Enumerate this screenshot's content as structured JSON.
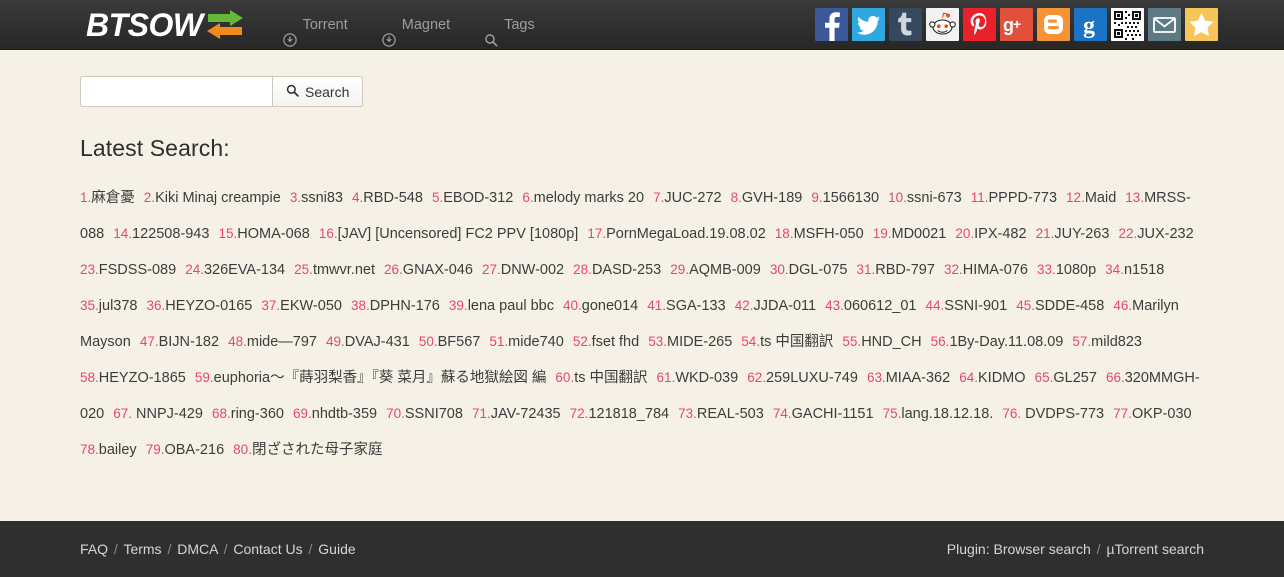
{
  "header": {
    "brand": "BTSOW",
    "nav": [
      {
        "label": "Torrent",
        "icon": "download-circle-icon"
      },
      {
        "label": "Magnet",
        "icon": "download-circle-icon"
      },
      {
        "label": "Tags",
        "icon": "search-icon"
      }
    ],
    "social": [
      {
        "name": "facebook",
        "glyph": "f",
        "color": "#3b5998"
      },
      {
        "name": "twitter",
        "glyph": "t",
        "color": "#2fa8e1"
      },
      {
        "name": "tumblr",
        "glyph": "t",
        "color": "#34495e"
      },
      {
        "name": "reddit",
        "glyph": "r",
        "color": "#f2f2f2"
      },
      {
        "name": "pinterest",
        "glyph": "P",
        "color": "#e8212b"
      },
      {
        "name": "google-plus",
        "glyph": "g+",
        "color": "#e0503b"
      },
      {
        "name": "blogger",
        "glyph": "B",
        "color": "#f79337"
      },
      {
        "name": "google",
        "glyph": "g",
        "color": "#1a73c4"
      },
      {
        "name": "qr-code",
        "glyph": "",
        "color": "#ffffff"
      },
      {
        "name": "email",
        "glyph": "",
        "color": "#5d7b84"
      },
      {
        "name": "favorite",
        "glyph": "",
        "color": "#f7c65a"
      }
    ]
  },
  "search": {
    "value": "",
    "placeholder": "",
    "button_label": "Search"
  },
  "main": {
    "latest_title": "Latest Search:",
    "items": [
      {
        "n": "1.",
        "text": "麻倉憂"
      },
      {
        "n": "2.",
        "text": "Kiki Minaj creampie"
      },
      {
        "n": "3.",
        "text": "ssni83"
      },
      {
        "n": "4.",
        "text": "RBD-548"
      },
      {
        "n": "5.",
        "text": "EBOD-312"
      },
      {
        "n": "6.",
        "text": "melody marks 20"
      },
      {
        "n": "7.",
        "text": "JUC-272"
      },
      {
        "n": "8.",
        "text": "GVH-189"
      },
      {
        "n": "9.",
        "text": "1566130"
      },
      {
        "n": "10.",
        "text": "ssni-673"
      },
      {
        "n": "11.",
        "text": "PPPD-773"
      },
      {
        "n": "12.",
        "text": "Maid"
      },
      {
        "n": "13.",
        "text": "MRSS-088"
      },
      {
        "n": "14.",
        "text": "122508-943"
      },
      {
        "n": "15.",
        "text": "HOMA-068"
      },
      {
        "n": "16.",
        "text": "[JAV] [Uncensored] FC2 PPV [1080p]"
      },
      {
        "n": "17.",
        "text": "PornMegaLoad.19.08.02"
      },
      {
        "n": "18.",
        "text": "MSFH-050"
      },
      {
        "n": "19.",
        "text": "MD0021"
      },
      {
        "n": "20.",
        "text": "IPX-482"
      },
      {
        "n": "21.",
        "text": "JUY-263"
      },
      {
        "n": "22.",
        "text": "JUX-232"
      },
      {
        "n": "23.",
        "text": "FSDSS-089"
      },
      {
        "n": "24.",
        "text": "326EVA-134"
      },
      {
        "n": "25.",
        "text": "tmwvr.net"
      },
      {
        "n": "26.",
        "text": "GNAX-046"
      },
      {
        "n": "27.",
        "text": "DNW-002"
      },
      {
        "n": "28.",
        "text": "DASD-253"
      },
      {
        "n": "29.",
        "text": "AQMB-009"
      },
      {
        "n": "30.",
        "text": "DGL-075"
      },
      {
        "n": "31.",
        "text": "RBD-797"
      },
      {
        "n": "32.",
        "text": "HIMA-076"
      },
      {
        "n": "33.",
        "text": "1080p"
      },
      {
        "n": "34.",
        "text": "n1518"
      },
      {
        "n": "35.",
        "text": "jul378"
      },
      {
        "n": "36.",
        "text": "HEYZO-0165"
      },
      {
        "n": "37.",
        "text": "EKW-050"
      },
      {
        "n": "38.",
        "text": "DPHN-176"
      },
      {
        "n": "39.",
        "text": "lena paul bbc"
      },
      {
        "n": "40.",
        "text": "gone014"
      },
      {
        "n": "41.",
        "text": "SGA-133"
      },
      {
        "n": "42.",
        "text": "JJDA-011"
      },
      {
        "n": "43.",
        "text": "060612_01"
      },
      {
        "n": "44.",
        "text": "SSNI-901"
      },
      {
        "n": "45.",
        "text": "SDDE-458"
      },
      {
        "n": "46.",
        "text": "Marilyn Mayson"
      },
      {
        "n": "47.",
        "text": "BIJN-182"
      },
      {
        "n": "48.",
        "text": "mide—797"
      },
      {
        "n": "49.",
        "text": "DVAJ-431"
      },
      {
        "n": "50.",
        "text": "BF567"
      },
      {
        "n": "51.",
        "text": "mide740"
      },
      {
        "n": "52.",
        "text": "fset fhd"
      },
      {
        "n": "53.",
        "text": "MIDE-265"
      },
      {
        "n": "54.",
        "text": "ts 中国翻訳"
      },
      {
        "n": "55.",
        "text": "HND_CH"
      },
      {
        "n": "56.",
        "text": "1By-Day.11.08.09"
      },
      {
        "n": "57.",
        "text": "mild823"
      },
      {
        "n": "58.",
        "text": "HEYZO-1865"
      },
      {
        "n": "59.",
        "text": "euphoria～『蒔羽梨香』『葵 菜月』蘇る地獄絵図 編"
      },
      {
        "n": "60.",
        "text": "ts 中国翻訳"
      },
      {
        "n": "61.",
        "text": "WKD-039"
      },
      {
        "n": "62.",
        "text": "259LUXU-749"
      },
      {
        "n": "63.",
        "text": "MIAA-362"
      },
      {
        "n": "64.",
        "text": "KIDMO"
      },
      {
        "n": "65.",
        "text": "GL257"
      },
      {
        "n": "66.",
        "text": "320MMGH-020"
      },
      {
        "n": "67.",
        "text": " NNPJ-429"
      },
      {
        "n": "68.",
        "text": "ring-360"
      },
      {
        "n": "69.",
        "text": "nhdtb-359"
      },
      {
        "n": "70.",
        "text": "SSNI708"
      },
      {
        "n": "71.",
        "text": "JAV-72435"
      },
      {
        "n": "72.",
        "text": "121818_784"
      },
      {
        "n": "73.",
        "text": "REAL-503"
      },
      {
        "n": "74.",
        "text": "GACHI-1151"
      },
      {
        "n": "75.",
        "text": "lang.18.12.18."
      },
      {
        "n": "76.",
        "text": " DVDPS-773"
      },
      {
        "n": "77.",
        "text": "OKP-030"
      },
      {
        "n": "78.",
        "text": "bailey"
      },
      {
        "n": "79.",
        "text": "OBA-216"
      },
      {
        "n": "80.",
        "text": "閉ざされた母子家庭"
      }
    ]
  },
  "footer": {
    "links": [
      {
        "label": "FAQ"
      },
      {
        "label": "Terms"
      },
      {
        "label": "DMCA"
      },
      {
        "label": "Contact Us"
      },
      {
        "label": "Guide"
      }
    ],
    "separator": "/",
    "plugin_prefix": "Plugin:",
    "plugin_links": [
      {
        "label": "Browser search"
      },
      {
        "label": "µTorrent search"
      }
    ]
  },
  "colors": {
    "accent_pink": "#e8447a",
    "page_bg": "#f5f1e6",
    "bar_bg": "#2f2f2f"
  }
}
